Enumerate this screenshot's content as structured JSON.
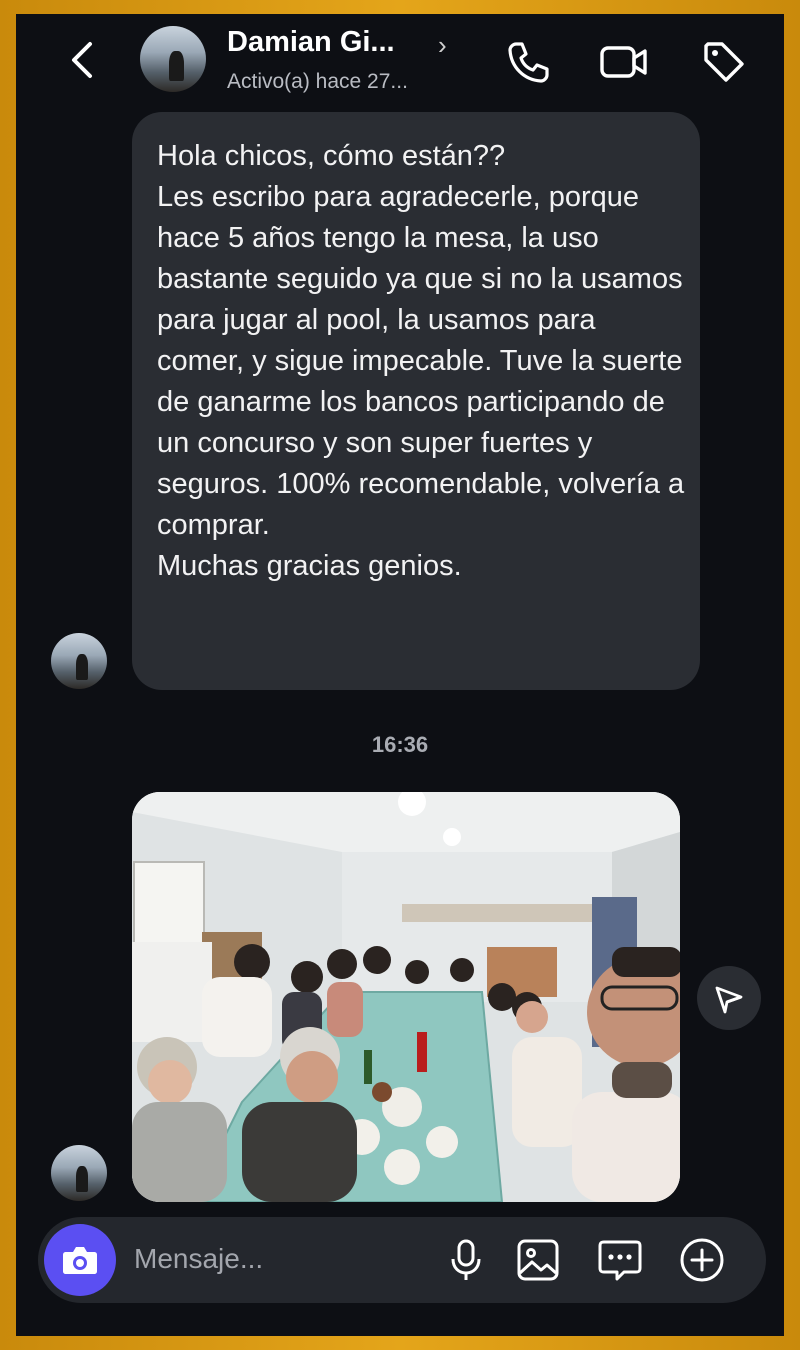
{
  "header": {
    "name": "Damian Gi...",
    "status": "Activo(a) hace 27...",
    "back_icon": "chevron-left-icon",
    "call_icon": "phone-icon",
    "video_icon": "video-camera-icon",
    "tag_icon": "tag-icon"
  },
  "message": {
    "text": "Hola chicos, cómo están??\nLes escribo para agradecerle, porque hace 5 años tengo la mesa, la uso bastante seguido ya que si no la usamos para jugar al pool, la usamos para comer, y sigue impecable. Tuve la suerte de ganarme los bancos participando de un concurso y son super fuertes y seguros. 100% recomendable, volvería a comprar.\nMuchas gracias genios."
  },
  "timestamp": "16:36",
  "composer": {
    "placeholder": "Mensaje...",
    "camera_icon": "camera-icon",
    "mic_icon": "microphone-icon",
    "gallery_icon": "image-icon",
    "sticker_icon": "chat-bubble-icon",
    "plus_icon": "plus-circle-icon"
  },
  "colors": {
    "background": "#0d0f14",
    "bubble": "#2a2d33",
    "accent": "#5b4ff2",
    "frame": "#d89a14"
  }
}
